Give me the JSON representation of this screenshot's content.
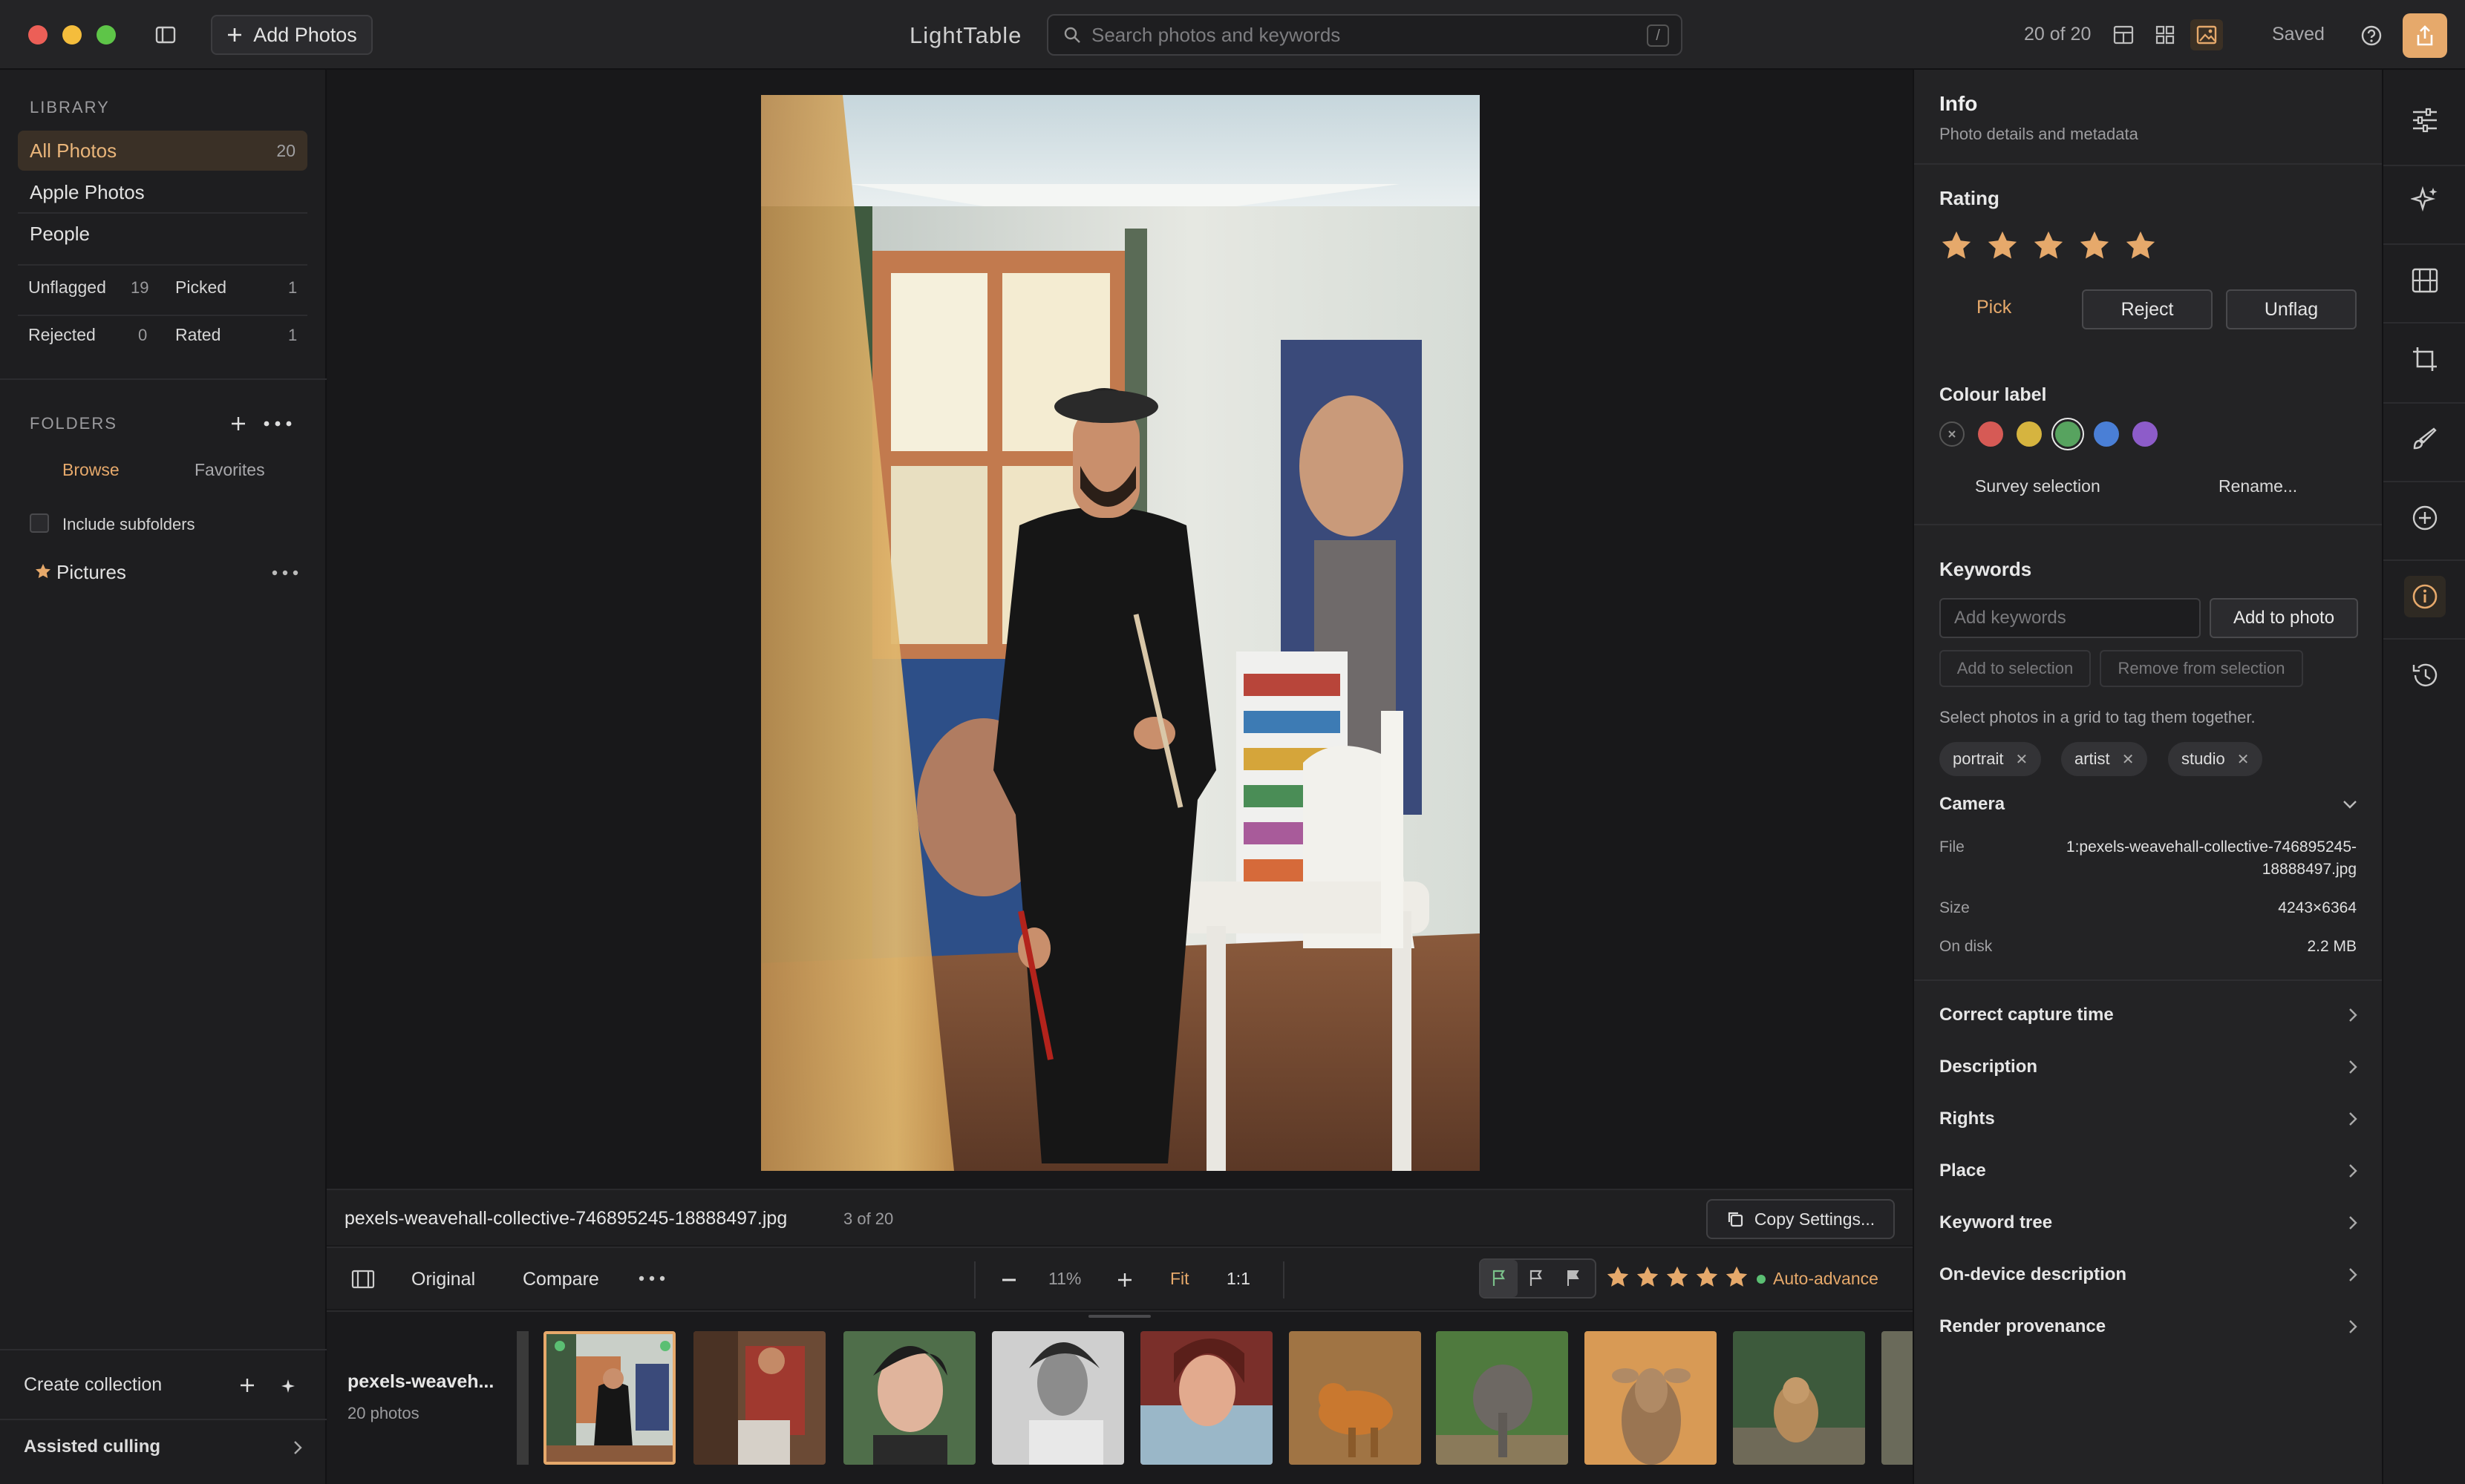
{
  "app": {
    "title": "LightTable",
    "saved": "Saved",
    "count": "20 of 20"
  },
  "toolbar": {
    "add_photos": "Add Photos",
    "search_placeholder": "Search photos and keywords",
    "search_shortcut": "/"
  },
  "sidebar": {
    "library_title": "LIBRARY",
    "library_items": [
      {
        "label": "All Photos",
        "count": "20"
      },
      {
        "label": "Apple Photos",
        "count": ""
      },
      {
        "label": "People",
        "count": ""
      }
    ],
    "stats": [
      {
        "label": "Unflagged",
        "count": "19"
      },
      {
        "label": "Picked",
        "count": "1"
      },
      {
        "label": "Rejected",
        "count": "0"
      },
      {
        "label": "Rated",
        "count": "1"
      }
    ],
    "folders_title": "FOLDERS",
    "folder_tabs": [
      "Browse",
      "Favorites"
    ],
    "include_subfolders": "Include subfolders",
    "folder": "Pictures",
    "create_collection": "Create collection",
    "assisted_culling": "Assisted culling"
  },
  "viewer": {
    "filename": "pexels-weavehall-collective-746895245-18888497.jpg",
    "position": "3 of 20",
    "copy_settings": "Copy Settings...",
    "original": "Original",
    "compare": "Compare",
    "zoom": "11%",
    "fit": "Fit",
    "one_to_one": "1:1",
    "auto_advance": "Auto-advance",
    "stars": 5
  },
  "filmstrip": {
    "title": "pexels-weaveh...",
    "subtitle": "20 photos"
  },
  "info": {
    "title": "Info",
    "subtitle": "Photo details and metadata",
    "rating_title": "Rating",
    "rating": 5,
    "pick": "Pick",
    "reject": "Reject",
    "unflag": "Unflag",
    "colour_title": "Colour label",
    "colours": [
      "#d65a55",
      "#d6b43f",
      "#57a35f",
      "#4a7fd6",
      "#8d5cc9"
    ],
    "survey_selection": "Survey selection",
    "rename": "Rename...",
    "keywords_title": "Keywords",
    "keywords_placeholder": "Add keywords",
    "add_to_photo": "Add to photo",
    "add_to_selection": "Add to selection",
    "remove_from_selection": "Remove from selection",
    "hint": "Select photos in a grid to tag them together.",
    "keywords": [
      "portrait",
      "artist",
      "studio"
    ],
    "camera_title": "Camera",
    "file_label": "File",
    "file_value_1": "1:pexels-weavehall-collective-746895245-",
    "file_value_2": "18888497.jpg",
    "size_label": "Size",
    "size_value": "4243×6364",
    "disk_label": "On disk",
    "disk_value": "2.2 MB",
    "sections": [
      "Correct capture time",
      "Description",
      "Rights",
      "Place",
      "Keyword tree",
      "On-device description",
      "Render provenance"
    ]
  },
  "colors": {
    "accent": "#e6a96b",
    "panel": "#232325",
    "background": "#18181a"
  }
}
